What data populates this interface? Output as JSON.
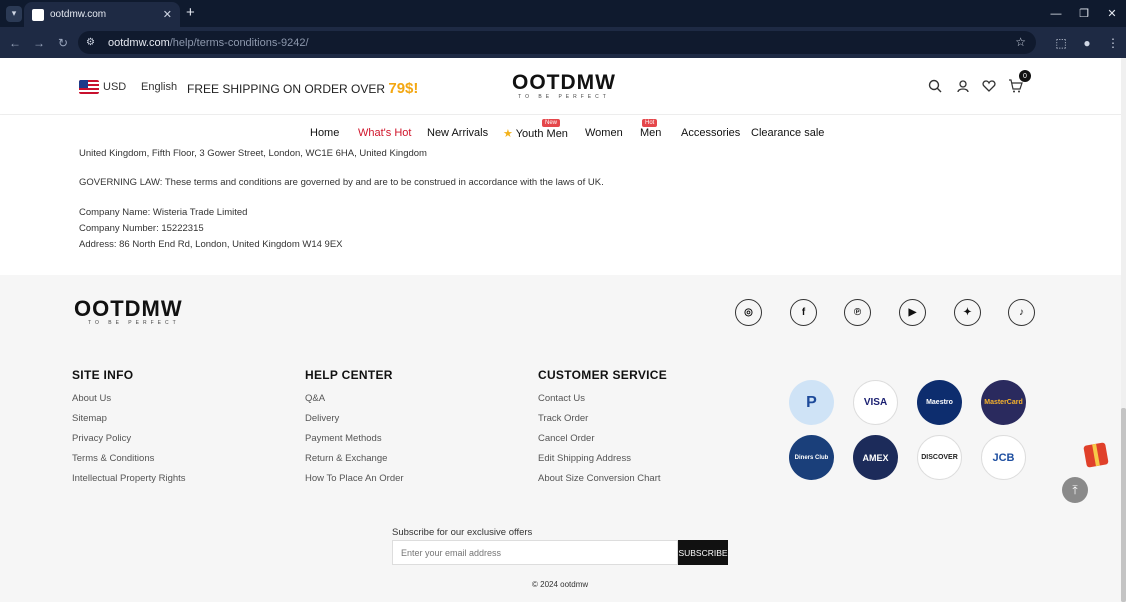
{
  "browser": {
    "tab_title": "ootdmw.com",
    "url_host": "ootdmw.com",
    "url_path": "/help/terms-conditions-9242/"
  },
  "header": {
    "currency": "USD",
    "language": "English",
    "shipping_text": "FREE SHIPPING ON ORDER OVER ",
    "shipping_amount": "79$!",
    "logo": "OOTDMW",
    "logo_tagline": "TO BE PERFECT",
    "cart_count": "0"
  },
  "menu": {
    "items": [
      {
        "label": "Home"
      },
      {
        "label": "What's Hot"
      },
      {
        "label": "New Arrivals"
      },
      {
        "label": "Youth Men",
        "badge": "New"
      },
      {
        "label": "Women"
      },
      {
        "label": "Men",
        "badge": "Hot"
      },
      {
        "label": "Accessories"
      },
      {
        "label": "Clearance sale"
      }
    ]
  },
  "content": {
    "address_line": "United Kingdom, Fifth Floor, 3 Gower Street, London, WC1E 6HA, United Kingdom",
    "governing_law": "GOVERNING LAW: These terms and conditions are governed by and are to be construed in accordance with the laws of UK.",
    "company_name": "Company Name: Wisteria Trade Limited",
    "company_number": "Company Number: 15222315",
    "address": "Address: 86 North End Rd, London, United Kingdom W14 9EX"
  },
  "footer": {
    "logo": "OOTDMW",
    "logo_tagline": "TO BE PERFECT",
    "site_info": {
      "title": "SITE INFO",
      "links": [
        "About Us",
        "Sitemap",
        "Privacy Policy",
        "Terms & Conditions",
        "Intellectual Property Rights"
      ]
    },
    "help_center": {
      "title": "HELP CENTER",
      "links": [
        "Q&A",
        "Delivery",
        "Payment Methods",
        "Return & Exchange",
        "How To Place An Order"
      ]
    },
    "customer_service": {
      "title": "CUSTOMER SERVICE",
      "links": [
        "Contact Us",
        "Track Order",
        "Cancel Order",
        "Edit Shipping Address",
        "About Size Conversion Chart"
      ]
    },
    "payments": [
      "P",
      "VISA",
      "Maestro",
      "MasterCard",
      "Diners Club",
      "AMEX",
      "DISCOVER",
      "JCB"
    ],
    "subscribe_label": "Subscribe for our exclusive offers",
    "email_placeholder": "Enter your email address",
    "subscribe_button": "SUBSCRIBE",
    "copyright": "© 2024 ootdmw"
  },
  "colors": {
    "accent_hot": "#d0142a",
    "shipping_amount": "#f3a712",
    "badge": "#e5474b"
  }
}
